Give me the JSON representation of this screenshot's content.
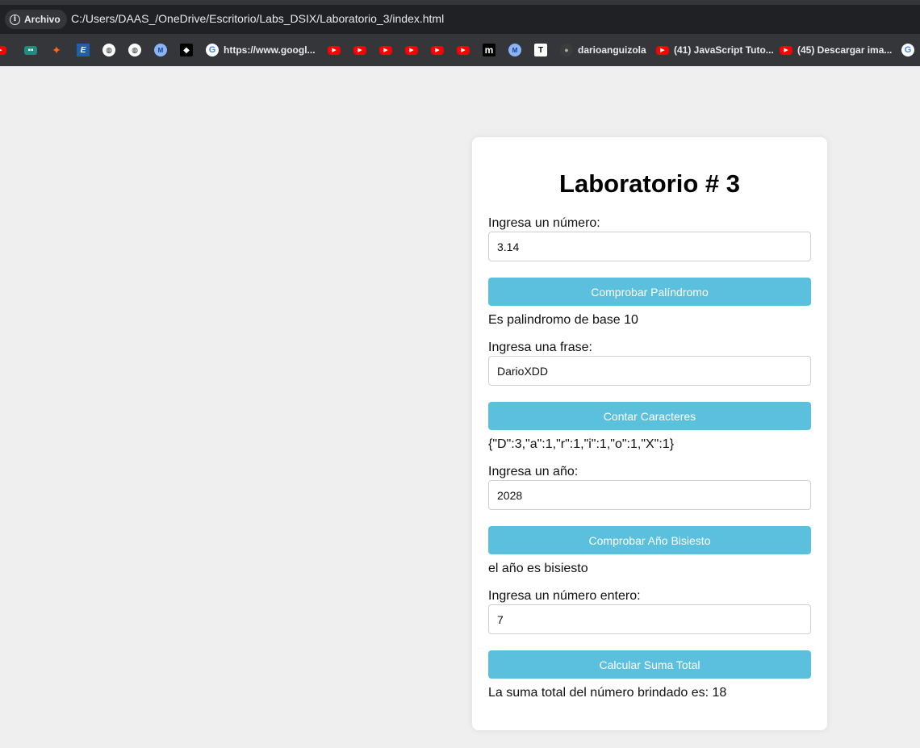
{
  "browser": {
    "chip_label": "Archivo",
    "url": "C:/Users/DAAS_/OneDrive/Escritorio/Labs_DSIX/Laboratorio_3/index.html",
    "bookmarks": [
      {
        "icon": "youtube-icon",
        "label": ""
      },
      {
        "icon": "teams-icon",
        "label": ""
      },
      {
        "icon": "rocket-icon",
        "label": ""
      },
      {
        "icon": "e-icon",
        "label": ""
      },
      {
        "icon": "globe-icon",
        "label": ""
      },
      {
        "icon": "globe-icon",
        "label": ""
      },
      {
        "icon": "meeting-icon",
        "label": ""
      },
      {
        "icon": "box-icon",
        "label": ""
      },
      {
        "icon": "google-icon",
        "label": "https://www.googl..."
      },
      {
        "icon": "youtube-icon",
        "label": ""
      },
      {
        "icon": "youtube-icon",
        "label": ""
      },
      {
        "icon": "youtube-icon",
        "label": ""
      },
      {
        "icon": "youtube-icon",
        "label": ""
      },
      {
        "icon": "youtube-icon",
        "label": ""
      },
      {
        "icon": "youtube-icon",
        "label": ""
      },
      {
        "icon": "medium-icon",
        "label": ""
      },
      {
        "icon": "meeting-icon",
        "label": ""
      },
      {
        "icon": "t-icon",
        "label": ""
      },
      {
        "icon": "github-icon",
        "label": "darioanguizola"
      },
      {
        "icon": "youtube-icon",
        "label": "(41) JavaScript Tuto..."
      },
      {
        "icon": "youtube-icon",
        "label": "(45) Descargar ima..."
      },
      {
        "icon": "google-icon",
        "label": ""
      }
    ]
  },
  "card": {
    "title": "Laboratorio # 3",
    "palindrome": {
      "label": "Ingresa un número:",
      "value": "3.14",
      "button": "Comprobar Palíndromo",
      "result": "Es palindromo de base 10"
    },
    "chars": {
      "label": "Ingresa una frase:",
      "value": "DarioXDD",
      "button": "Contar Caracteres",
      "result": "{\"D\":3,\"a\":1,\"r\":1,\"i\":1,\"o\":1,\"X\":1}"
    },
    "leap": {
      "label": "Ingresa un año:",
      "value": "2028",
      "button": "Comprobar Año Bisiesto",
      "result": "el año es bisiesto"
    },
    "sum": {
      "label": "Ingresa un número entero:",
      "value": "7",
      "button": "Calcular Suma Total",
      "result": "La suma total del número brindado es: 18"
    }
  },
  "colors": {
    "button_bg": "#5bc0de",
    "page_bg": "#efefef",
    "chrome_bg": "#202124"
  }
}
